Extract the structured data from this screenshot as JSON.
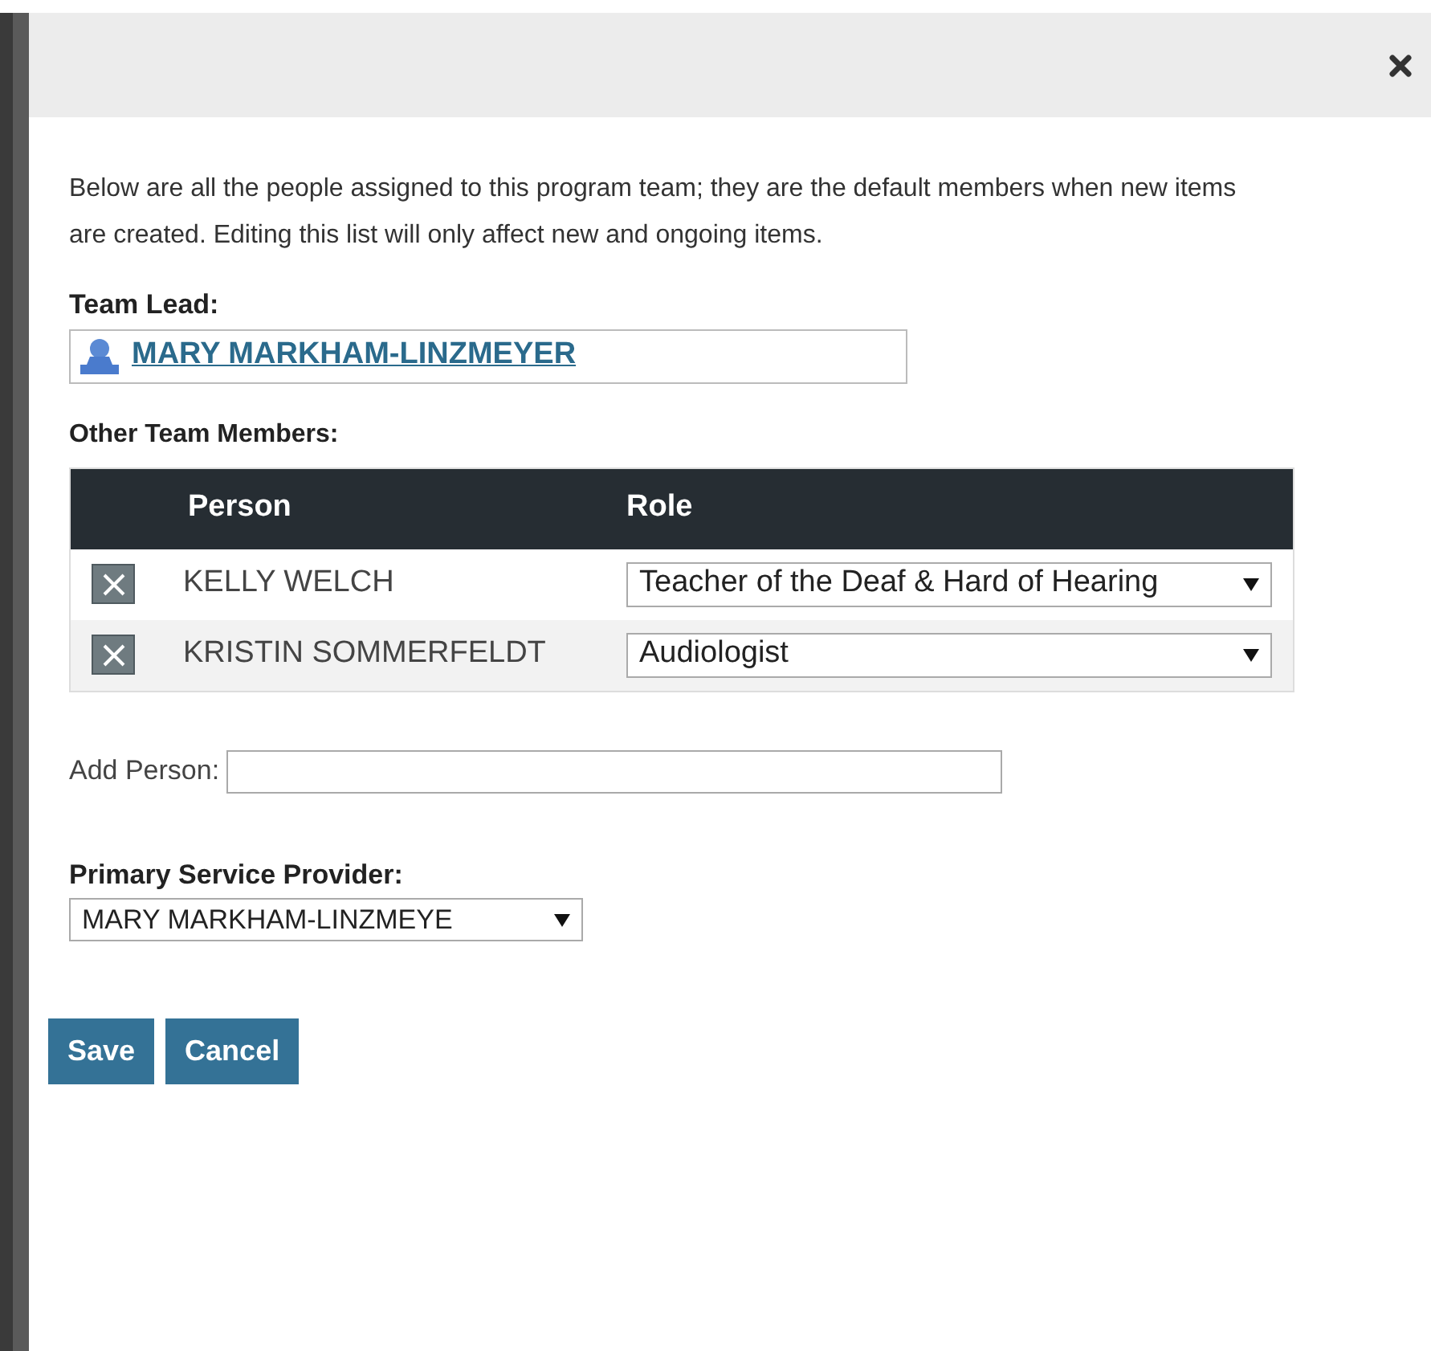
{
  "dialog": {
    "intro": "Below are all the people assigned to this program team; they are the default members when new items are created. Editing this list will only affect new and ongoing items.",
    "team_lead": {
      "label": "Team Lead:",
      "name": "MARY MARKHAM-LINZMEYER"
    },
    "members": {
      "label": "Other Team Members:",
      "columns": [
        "Person",
        "Role"
      ],
      "rows": [
        {
          "person": "KELLY WELCH",
          "role": "Teacher of the Deaf & Hard of Hearing"
        },
        {
          "person": "KRISTIN SOMMERFELDT",
          "role": "Audiologist"
        }
      ]
    },
    "add_person": {
      "label": "Add Person:"
    },
    "primary_provider": {
      "label": "Primary Service Provider:",
      "value": "MARY MARKHAM-LINZMEYE"
    },
    "buttons": [
      "Save",
      "Cancel"
    ]
  }
}
